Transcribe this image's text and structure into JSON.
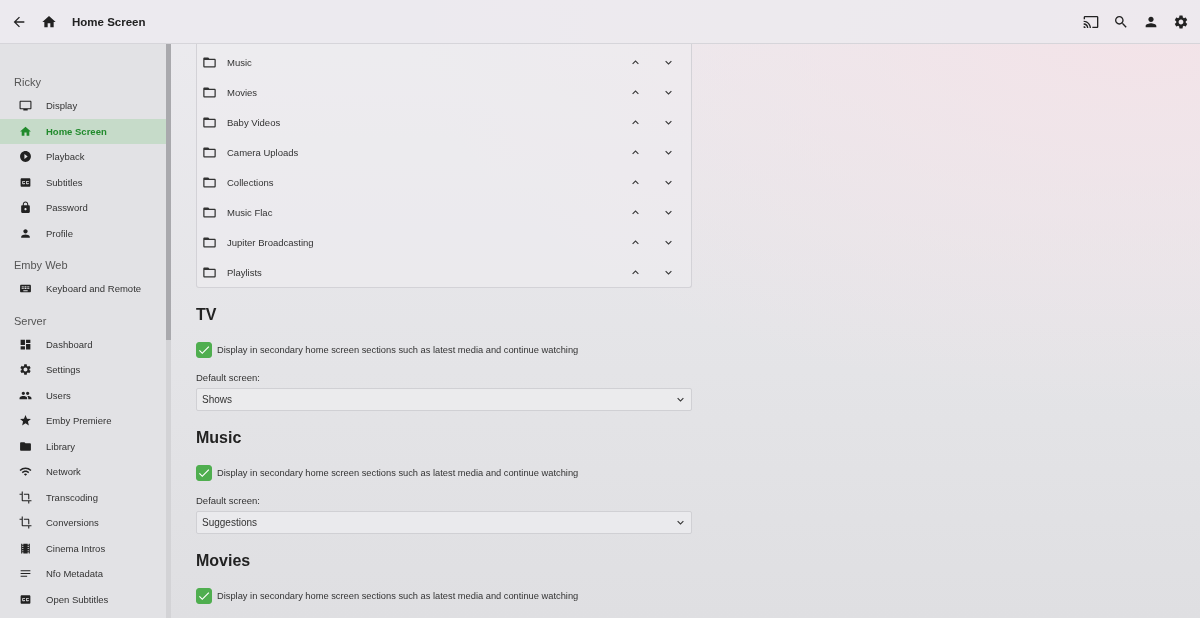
{
  "header": {
    "title": "Home Screen"
  },
  "sidebar": {
    "sections": [
      {
        "title": "Ricky",
        "items": [
          {
            "label": "Display",
            "kind": "tv",
            "selected": false
          },
          {
            "label": "Home Screen",
            "kind": "home",
            "selected": true
          },
          {
            "label": "Playback",
            "kind": "play",
            "selected": false
          },
          {
            "label": "Subtitles",
            "kind": "cc",
            "selected": false
          },
          {
            "label": "Password",
            "kind": "lock",
            "selected": false
          },
          {
            "label": "Profile",
            "kind": "person",
            "selected": false
          }
        ]
      },
      {
        "title": "Emby Web",
        "items": [
          {
            "label": "Keyboard and Remote",
            "kind": "keyboard",
            "selected": false
          }
        ]
      },
      {
        "title": "Server",
        "items": [
          {
            "label": "Dashboard",
            "kind": "dashboard",
            "selected": false
          },
          {
            "label": "Settings",
            "kind": "gear",
            "selected": false
          },
          {
            "label": "Users",
            "kind": "people",
            "selected": false
          },
          {
            "label": "Emby Premiere",
            "kind": "star",
            "selected": false
          },
          {
            "label": "Library",
            "kind": "folder",
            "selected": false
          },
          {
            "label": "Network",
            "kind": "wifi",
            "selected": false
          },
          {
            "label": "Transcoding",
            "kind": "crop",
            "selected": false
          },
          {
            "label": "Conversions",
            "kind": "crop",
            "selected": false
          },
          {
            "label": "Cinema Intros",
            "kind": "film",
            "selected": false
          },
          {
            "label": "Nfo Metadata",
            "kind": "lines",
            "selected": false
          },
          {
            "label": "Open Subtitles",
            "kind": "cc",
            "selected": false
          }
        ]
      }
    ]
  },
  "libraries": [
    {
      "name": "Music"
    },
    {
      "name": "Movies"
    },
    {
      "name": "Baby Videos"
    },
    {
      "name": "Camera Uploads"
    },
    {
      "name": "Collections"
    },
    {
      "name": "Music Flac"
    },
    {
      "name": "Jupiter Broadcasting"
    },
    {
      "name": "Playlists"
    }
  ],
  "sections": [
    {
      "title": "TV",
      "checkbox": {
        "label": "Display in secondary home screen sections such as latest media and continue watching",
        "checked": true
      },
      "default_screen": {
        "label": "Default screen:",
        "value": "Shows"
      }
    },
    {
      "title": "Music",
      "checkbox": {
        "label": "Display in secondary home screen sections such as latest media and continue watching",
        "checked": true
      },
      "default_screen": {
        "label": "Default screen:",
        "value": "Suggestions"
      }
    },
    {
      "title": "Movies",
      "checkbox": {
        "label": "Display in secondary home screen sections such as latest media and continue watching",
        "checked": true
      }
    }
  ]
}
